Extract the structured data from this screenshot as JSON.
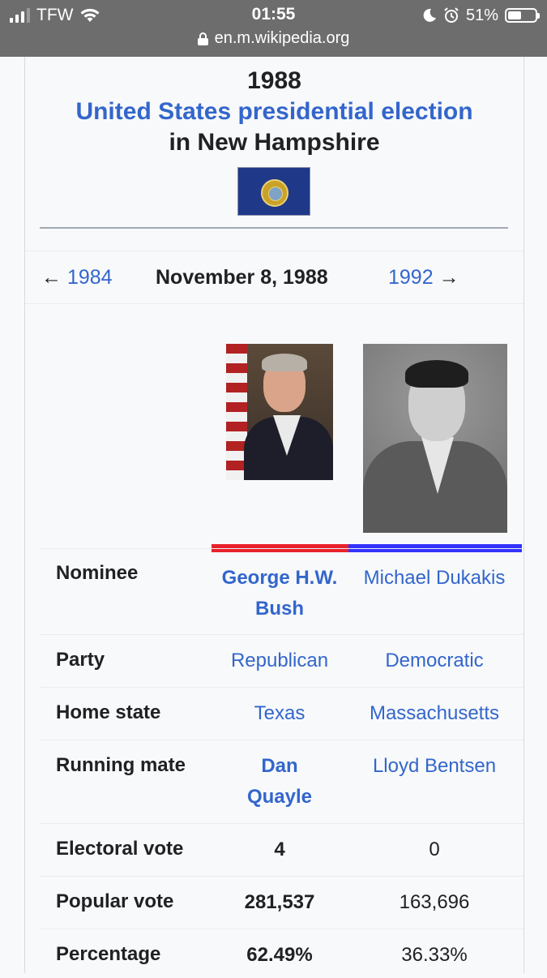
{
  "status_bar": {
    "carrier": "TFW",
    "time": "01:55",
    "battery": "51%",
    "battery_level": 0.51,
    "url": "en.m.wikipedia.org"
  },
  "infobox": {
    "year": "1988",
    "title_link": "United States presidential election",
    "title_suffix": "in New Hampshire",
    "nav": {
      "prev_arrow": "←",
      "prev": "1984",
      "date": "November 8, 1988",
      "next": "1992",
      "next_arrow": "→"
    },
    "colors": {
      "republican": "#e9212b",
      "democratic": "#3333ff",
      "link": "#3366cc"
    },
    "rows": {
      "nominee": {
        "label": "Nominee",
        "c1": "George H.W. Bush",
        "c2": "Michael Dukakis"
      },
      "party": {
        "label": "Party",
        "c1": "Republican",
        "c2": "Democratic"
      },
      "home_state": {
        "label": "Home state",
        "c1": "Texas",
        "c2": "Massachusetts"
      },
      "running_mate": {
        "label": "Running mate",
        "c1": "Dan Quayle",
        "c2": "Lloyd Bentsen"
      },
      "electoral_vote": {
        "label": "Electoral vote",
        "c1": "4",
        "c2": "0"
      },
      "popular_vote": {
        "label": "Popular vote",
        "c1": "281,537",
        "c2": "163,696"
      },
      "percentage": {
        "label": "Percentage",
        "c1": "62.49%",
        "c2": "36.33%"
      }
    }
  }
}
